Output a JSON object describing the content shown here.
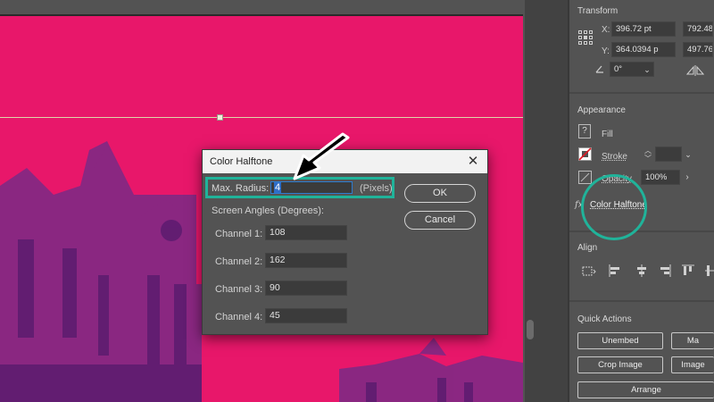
{
  "dialog": {
    "title": "Color Halftone",
    "close_glyph": "✕",
    "max_radius_label": "Max. Radius:",
    "max_radius_value": "4",
    "max_radius_unit": "(Pixels)",
    "screen_angles_label": "Screen Angles (Degrees):",
    "channels": [
      {
        "label": "Channel 1:",
        "value": "108"
      },
      {
        "label": "Channel 2:",
        "value": "162"
      },
      {
        "label": "Channel 3:",
        "value": "90"
      },
      {
        "label": "Channel 4:",
        "value": "45"
      }
    ],
    "ok_label": "OK",
    "cancel_label": "Cancel"
  },
  "panel": {
    "transform": {
      "title": "Transform",
      "x_label": "X:",
      "x_value": "396.72 pt",
      "y_label": "Y:",
      "y_value": "364.0394 p",
      "w_label": "W:",
      "w_value": "792.48",
      "h_label": "H:",
      "h_value": "497.76",
      "rotation_value": "0°"
    },
    "appearance": {
      "title": "Appearance",
      "fill_label": "Fill",
      "stroke_label": "Stroke",
      "opacity_label": "Opacity",
      "opacity_value": "100%",
      "effect_label": "Color Halftone",
      "fx_glyph": "fx",
      "question_glyph": "?"
    },
    "align": {
      "title": "Align"
    },
    "quick_actions": {
      "title": "Quick Actions",
      "unembed_label": "Unembed",
      "mask_label": "Ma",
      "crop_label": "Crop Image",
      "image_trace_label": "Image",
      "arrange_label": "Arrange"
    }
  },
  "colors": {
    "artboard": "#e8176a",
    "highlight": "#20b39a",
    "panel_bg": "#535353",
    "dialog_title_bg": "#f2f2f2"
  }
}
